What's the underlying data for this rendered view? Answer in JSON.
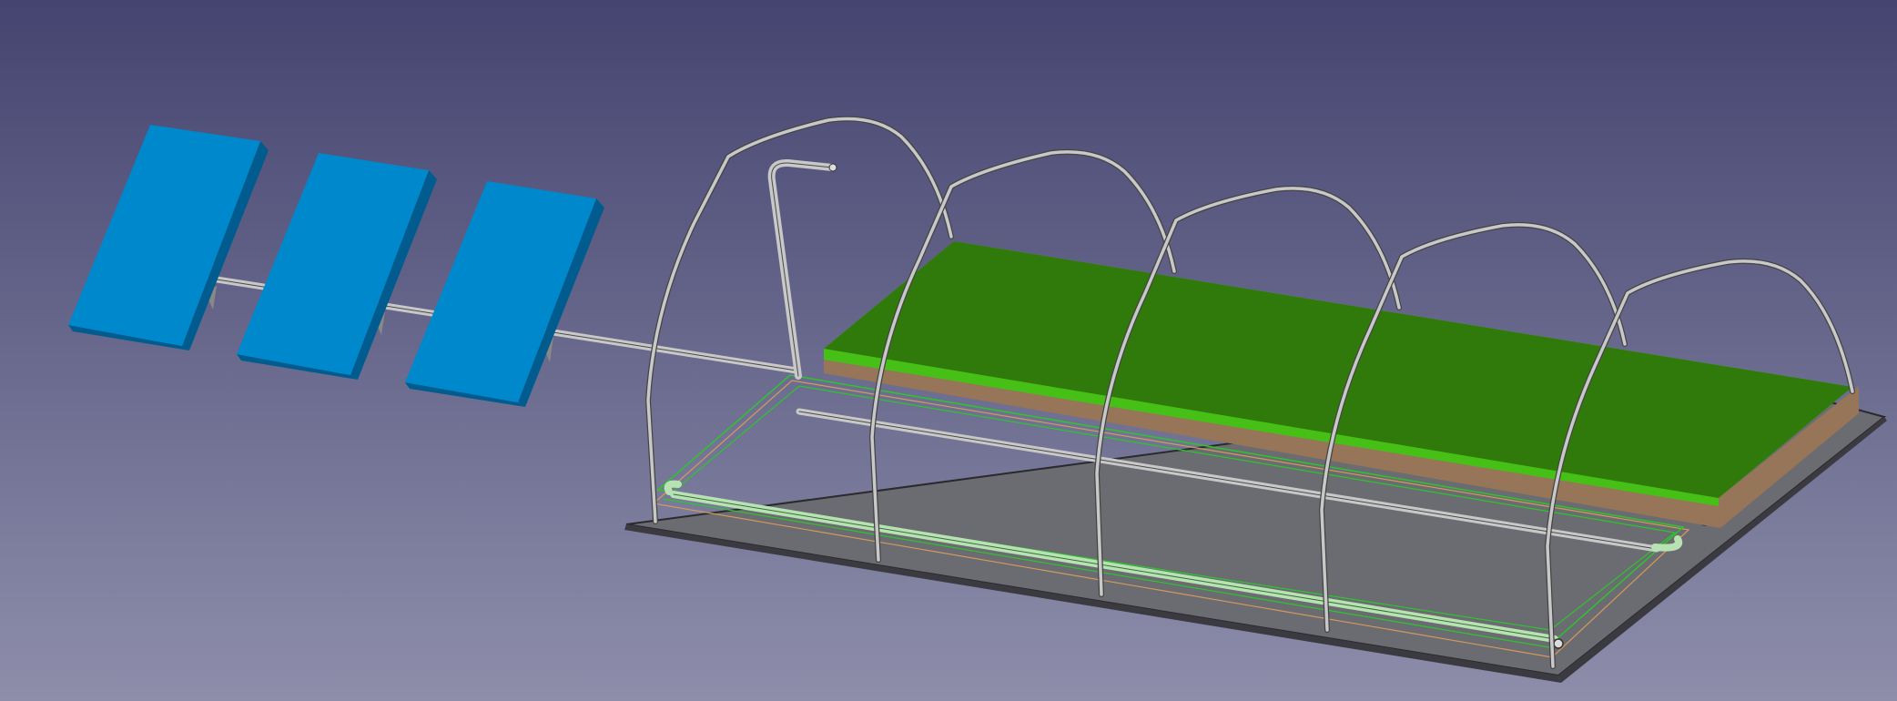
{
  "viewport": {
    "kind": "3D model view",
    "background": {
      "top": "#444470",
      "bottom": "#8e8eab"
    }
  },
  "colors": {
    "panel_top": "#0088cc",
    "panel_side": "#005c8f",
    "pipe": "#c8c8c8",
    "pipe_outline": "#4a4a4a",
    "soil": "#967559",
    "grass_edge": "#46c016",
    "grass_top": "#2f7a0a",
    "ground_plate": "#6b6b72",
    "selection_green": "#2cc62c",
    "selection_orange": "#d49a5c",
    "drip_pipe_selected": "#b7e3b2"
  },
  "model": {
    "solar_panel_count": 3,
    "hoop_arch_count": 5,
    "objects": [
      "solar-panel-array",
      "supply-pipe",
      "greenhouse-hoops",
      "planting-bed",
      "ground-plate",
      "drip-irrigation-loop"
    ]
  }
}
